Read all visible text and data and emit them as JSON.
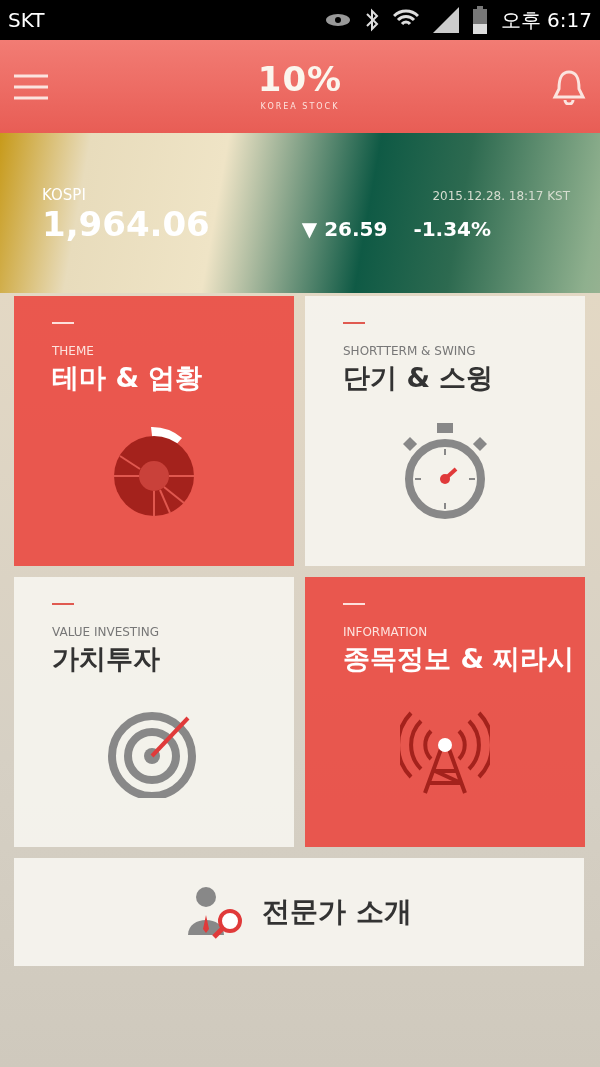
{
  "status_bar": {
    "carrier": "SKT",
    "time": "오후 6:17"
  },
  "header": {
    "logo": "10%",
    "logo_subtitle": "KOREA STOCK"
  },
  "market": {
    "index_name": "KOSPI",
    "value": "1,964.06",
    "change": "▼ 26.59",
    "change_percent": "-1.34%",
    "timestamp": "2015.12.28. 18:17 KST"
  },
  "tiles": [
    {
      "kind": "red",
      "subtitle": "THEME",
      "title": "테마 & 업황"
    },
    {
      "kind": "light",
      "subtitle": "SHORTTERM & SWING",
      "title": "단기 & 스윙"
    },
    {
      "kind": "light",
      "subtitle": "VALUE INVESTING",
      "title": "가치투자"
    },
    {
      "kind": "red",
      "subtitle": "INFORMATION",
      "title": "종목정보 & 찌라시"
    }
  ],
  "expert_button": {
    "label": "전문가 소개"
  }
}
